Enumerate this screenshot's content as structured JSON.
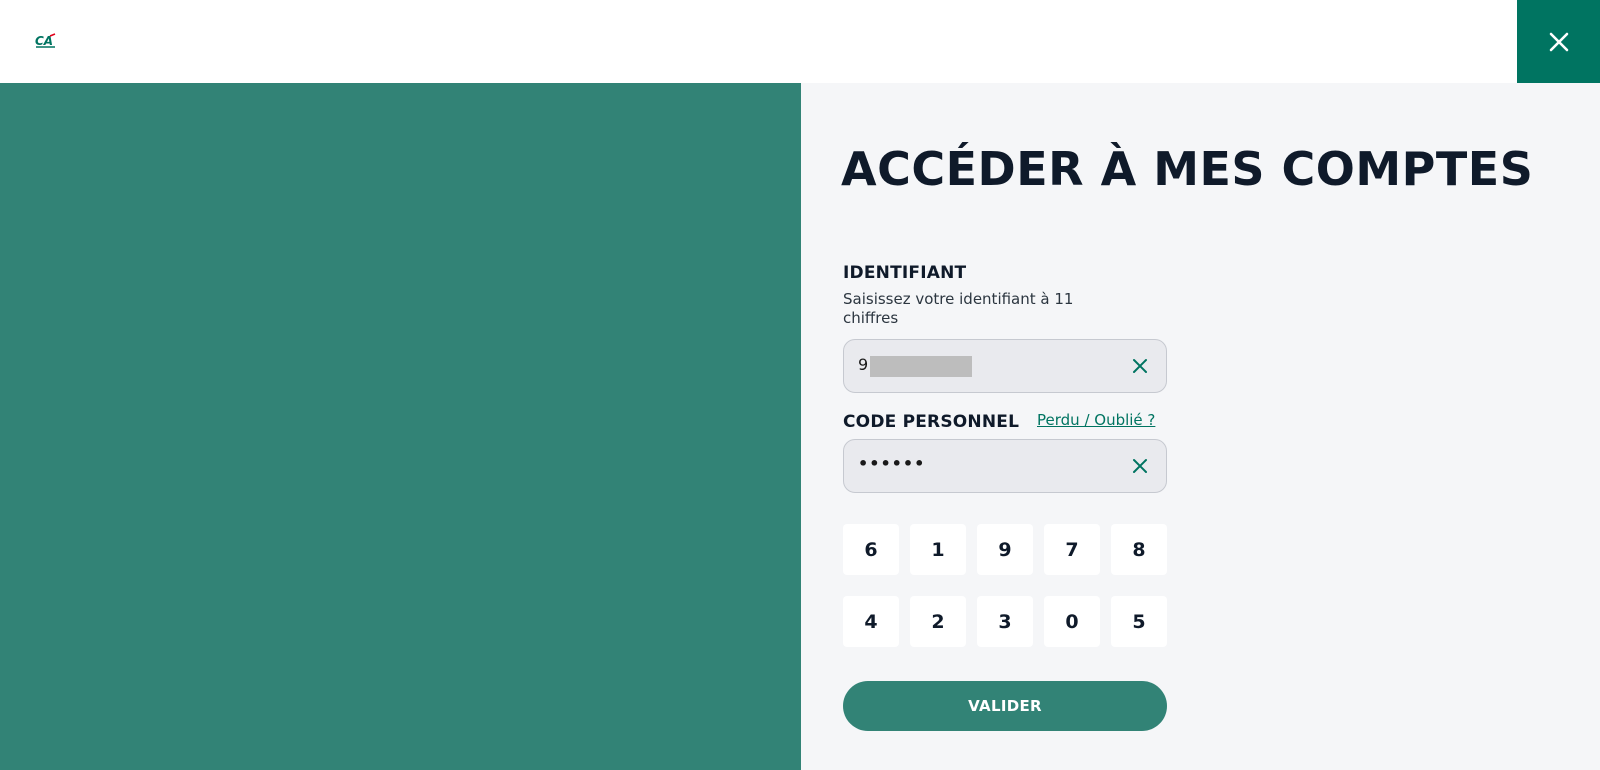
{
  "header": {
    "logo_icon": "credit-agricole-logo",
    "close_icon": "close-icon",
    "accent_color": "#007461"
  },
  "login": {
    "title": "ACCÉDER À MES COMPTES",
    "identifier": {
      "label": "IDENTIFIANT",
      "help": "Saisissez votre identifiant à 11 chiffres",
      "value": "9"
    },
    "code": {
      "label": "CODE PERSONNEL",
      "forgot_link": "Perdu / Oublié ?",
      "value": "••••••"
    },
    "keypad": {
      "row1": [
        "6",
        "1",
        "9",
        "7",
        "8"
      ],
      "row2": [
        "4",
        "2",
        "3",
        "0",
        "5"
      ]
    },
    "submit_label": "VALIDER"
  },
  "colors": {
    "panel_green": "#328376",
    "background": "#f5f6f8",
    "title_color": "#0f1a2a"
  }
}
